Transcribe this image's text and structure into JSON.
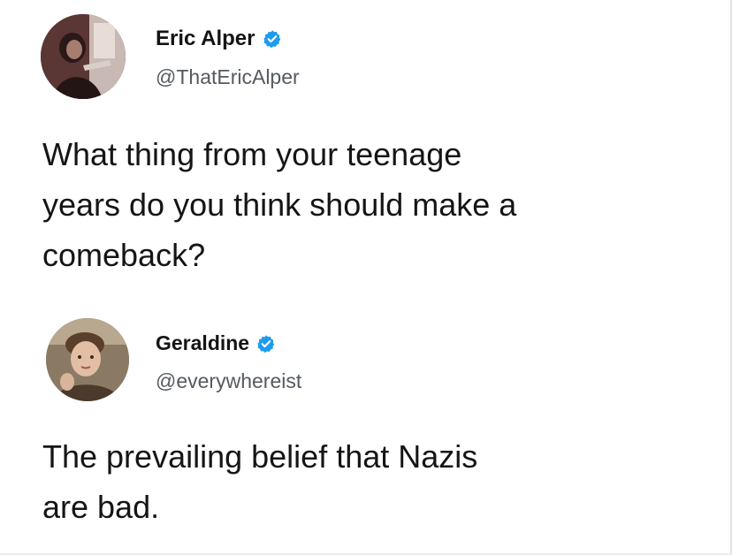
{
  "tweets": [
    {
      "name": "Eric Alper",
      "handle": "@ThatEricAlper",
      "verified": true,
      "text_lines": [
        "What thing from your teenage",
        "years do you think should make a",
        "comeback?"
      ]
    },
    {
      "name": "Geraldine",
      "handle": "@everywhereist",
      "verified": true,
      "text_lines": [
        "The prevailing belief that Nazis",
        "are bad."
      ]
    }
  ],
  "colors": {
    "verified_badge": "#1d9bf0",
    "handle": "#555a60",
    "text": "#151515"
  },
  "icons": {
    "verified": "verified-badge-icon"
  }
}
